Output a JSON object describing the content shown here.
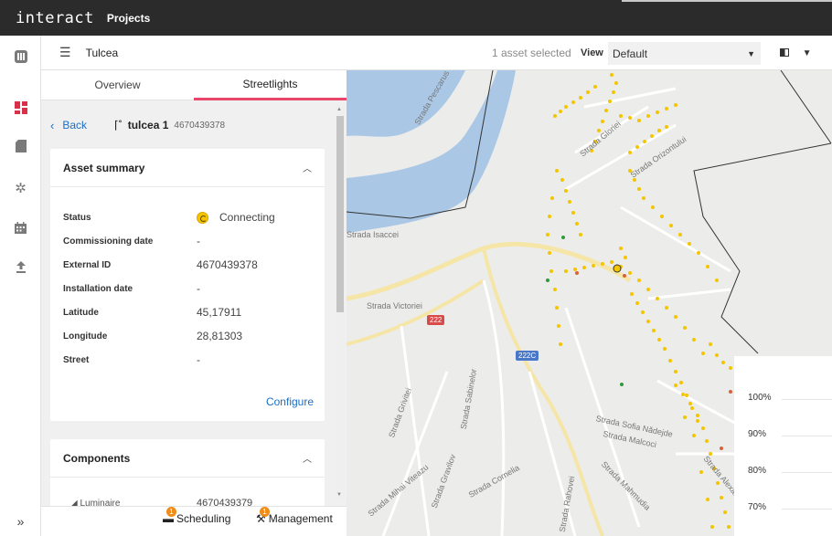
{
  "app": {
    "brand": "interact",
    "section": "Projects"
  },
  "header": {
    "project": "Tulcea",
    "selection": "1 asset selected",
    "view_label": "View",
    "view_value": "Default"
  },
  "tabs": [
    {
      "label": "Overview"
    },
    {
      "label": "Streetlights"
    }
  ],
  "asset": {
    "back_label": "Back",
    "name": "tulcea 1",
    "id": "4670439378"
  },
  "summary": {
    "title": "Asset summary",
    "rows": [
      {
        "k": "Status",
        "v": "Connecting"
      },
      {
        "k": "Commissioning date",
        "v": "-"
      },
      {
        "k": "External ID",
        "v": "4670439378"
      },
      {
        "k": "Installation date",
        "v": "-"
      },
      {
        "k": "Latitude",
        "v": "45,17911"
      },
      {
        "k": "Longitude",
        "v": "28,81303"
      },
      {
        "k": "Street",
        "v": "-"
      }
    ],
    "configure": "Configure"
  },
  "components": {
    "title": "Components",
    "first_row_label": "Luminaire",
    "first_row_value": "4670439379"
  },
  "bottom": [
    {
      "label": "Scheduling",
      "badge": "1"
    },
    {
      "label": "Management",
      "badge": "1"
    }
  ],
  "map": {
    "labels": [
      "Strada Victoriei",
      "Strada Sofia Nădejde",
      "Strada Malcoci",
      "Strada Sabinelor",
      "Strada Gravilov",
      "Strada Mihai Viteazu",
      "Strada Grivitei",
      "Strada Gloriei",
      "Strada Orizontului",
      "Strada Pescarus",
      "Strada Isaccei",
      "Strada Mahmudia",
      "Strada Rahovei",
      "Strada Alexandru",
      "Strada Cornelia"
    ],
    "road_badges": [
      "222",
      "222C"
    ],
    "chart_ticks": [
      "100%",
      "90%",
      "80%",
      "70%"
    ]
  },
  "colors": {
    "accent": "#e8466b",
    "link": "#1a6fc4",
    "light": "#f5c400",
    "water": "#aac8e6"
  }
}
